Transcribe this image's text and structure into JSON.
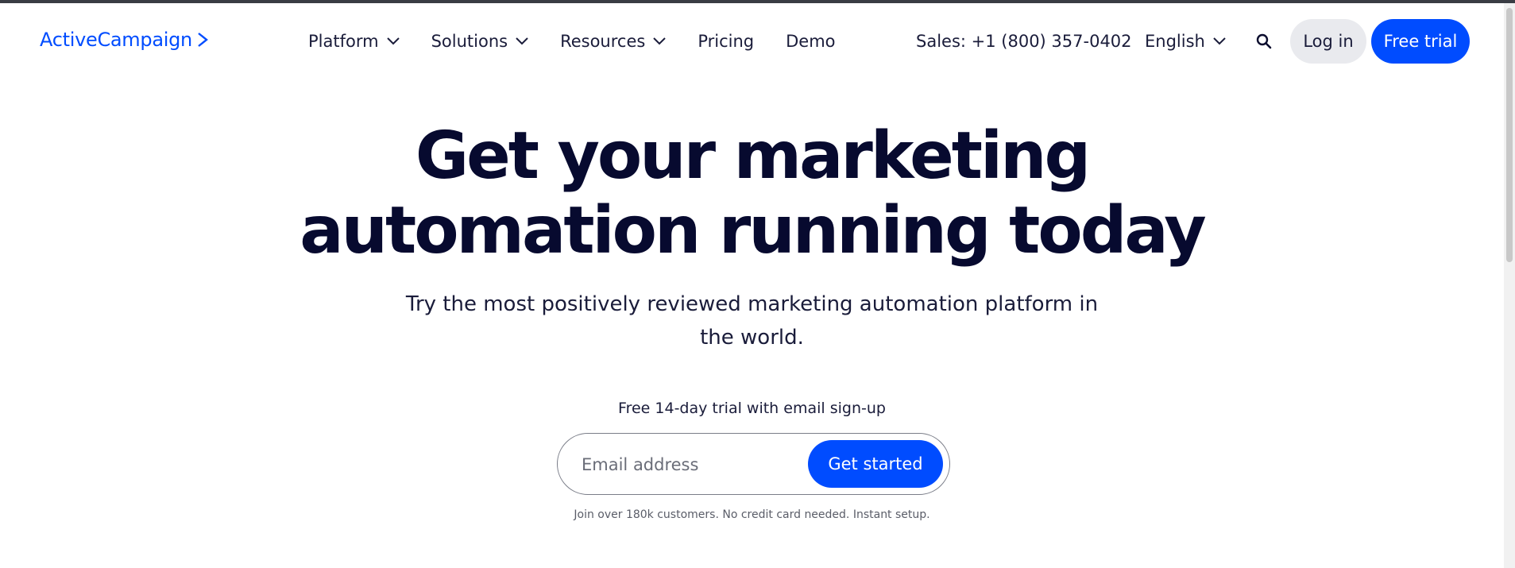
{
  "brand": {
    "name": "ActiveCampaign",
    "color": "#004cff"
  },
  "nav": {
    "items": [
      {
        "label": "Platform",
        "has_dropdown": true
      },
      {
        "label": "Solutions",
        "has_dropdown": true
      },
      {
        "label": "Resources",
        "has_dropdown": true
      },
      {
        "label": "Pricing",
        "has_dropdown": false
      },
      {
        "label": "Demo",
        "has_dropdown": false
      }
    ],
    "sales": "Sales: +1 (800) 357-0402",
    "language": "English",
    "search_icon": "search-icon",
    "login_label": "Log in",
    "trial_label": "Free trial"
  },
  "hero": {
    "title_line1": "Get your marketing",
    "title_line2": "automation running today",
    "subtitle_line1": "Try the most positively reviewed marketing automation platform in",
    "subtitle_line2": "the world.",
    "trial_note": "Free 14-day trial with email sign-up",
    "email_placeholder": "Email address",
    "cta_label": "Get started",
    "fineprint": "Join over 180k customers. No credit card needed. Instant setup."
  },
  "colors": {
    "primary_button": "#004cff",
    "secondary_button": "#e9eaee",
    "heading": "#070a2f"
  }
}
